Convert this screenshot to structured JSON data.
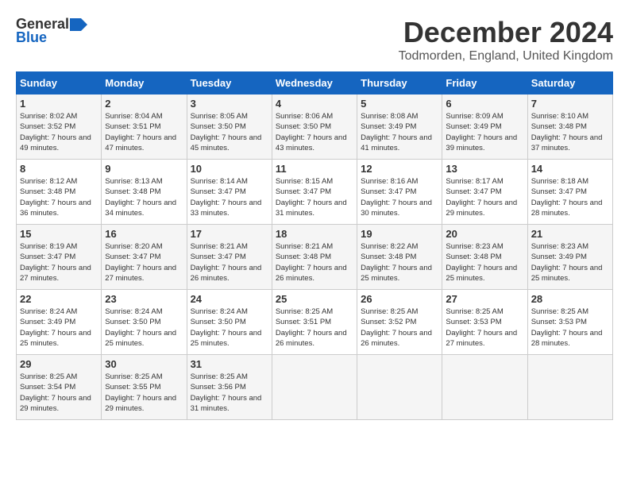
{
  "header": {
    "logo_general": "General",
    "logo_blue": "Blue",
    "month_title": "December 2024",
    "location": "Todmorden, England, United Kingdom"
  },
  "days_of_week": [
    "Sunday",
    "Monday",
    "Tuesday",
    "Wednesday",
    "Thursday",
    "Friday",
    "Saturday"
  ],
  "weeks": [
    [
      {
        "day": "1",
        "sunrise": "8:02 AM",
        "sunset": "3:52 PM",
        "daylight": "7 hours and 49 minutes."
      },
      {
        "day": "2",
        "sunrise": "8:04 AM",
        "sunset": "3:51 PM",
        "daylight": "7 hours and 47 minutes."
      },
      {
        "day": "3",
        "sunrise": "8:05 AM",
        "sunset": "3:50 PM",
        "daylight": "7 hours and 45 minutes."
      },
      {
        "day": "4",
        "sunrise": "8:06 AM",
        "sunset": "3:50 PM",
        "daylight": "7 hours and 43 minutes."
      },
      {
        "day": "5",
        "sunrise": "8:08 AM",
        "sunset": "3:49 PM",
        "daylight": "7 hours and 41 minutes."
      },
      {
        "day": "6",
        "sunrise": "8:09 AM",
        "sunset": "3:49 PM",
        "daylight": "7 hours and 39 minutes."
      },
      {
        "day": "7",
        "sunrise": "8:10 AM",
        "sunset": "3:48 PM",
        "daylight": "7 hours and 37 minutes."
      }
    ],
    [
      {
        "day": "8",
        "sunrise": "8:12 AM",
        "sunset": "3:48 PM",
        "daylight": "7 hours and 36 minutes."
      },
      {
        "day": "9",
        "sunrise": "8:13 AM",
        "sunset": "3:48 PM",
        "daylight": "7 hours and 34 minutes."
      },
      {
        "day": "10",
        "sunrise": "8:14 AM",
        "sunset": "3:47 PM",
        "daylight": "7 hours and 33 minutes."
      },
      {
        "day": "11",
        "sunrise": "8:15 AM",
        "sunset": "3:47 PM",
        "daylight": "7 hours and 31 minutes."
      },
      {
        "day": "12",
        "sunrise": "8:16 AM",
        "sunset": "3:47 PM",
        "daylight": "7 hours and 30 minutes."
      },
      {
        "day": "13",
        "sunrise": "8:17 AM",
        "sunset": "3:47 PM",
        "daylight": "7 hours and 29 minutes."
      },
      {
        "day": "14",
        "sunrise": "8:18 AM",
        "sunset": "3:47 PM",
        "daylight": "7 hours and 28 minutes."
      }
    ],
    [
      {
        "day": "15",
        "sunrise": "8:19 AM",
        "sunset": "3:47 PM",
        "daylight": "7 hours and 27 minutes."
      },
      {
        "day": "16",
        "sunrise": "8:20 AM",
        "sunset": "3:47 PM",
        "daylight": "7 hours and 27 minutes."
      },
      {
        "day": "17",
        "sunrise": "8:21 AM",
        "sunset": "3:47 PM",
        "daylight": "7 hours and 26 minutes."
      },
      {
        "day": "18",
        "sunrise": "8:21 AM",
        "sunset": "3:48 PM",
        "daylight": "7 hours and 26 minutes."
      },
      {
        "day": "19",
        "sunrise": "8:22 AM",
        "sunset": "3:48 PM",
        "daylight": "7 hours and 25 minutes."
      },
      {
        "day": "20",
        "sunrise": "8:23 AM",
        "sunset": "3:48 PM",
        "daylight": "7 hours and 25 minutes."
      },
      {
        "day": "21",
        "sunrise": "8:23 AM",
        "sunset": "3:49 PM",
        "daylight": "7 hours and 25 minutes."
      }
    ],
    [
      {
        "day": "22",
        "sunrise": "8:24 AM",
        "sunset": "3:49 PM",
        "daylight": "7 hours and 25 minutes."
      },
      {
        "day": "23",
        "sunrise": "8:24 AM",
        "sunset": "3:50 PM",
        "daylight": "7 hours and 25 minutes."
      },
      {
        "day": "24",
        "sunrise": "8:24 AM",
        "sunset": "3:50 PM",
        "daylight": "7 hours and 25 minutes."
      },
      {
        "day": "25",
        "sunrise": "8:25 AM",
        "sunset": "3:51 PM",
        "daylight": "7 hours and 26 minutes."
      },
      {
        "day": "26",
        "sunrise": "8:25 AM",
        "sunset": "3:52 PM",
        "daylight": "7 hours and 26 minutes."
      },
      {
        "day": "27",
        "sunrise": "8:25 AM",
        "sunset": "3:53 PM",
        "daylight": "7 hours and 27 minutes."
      },
      {
        "day": "28",
        "sunrise": "8:25 AM",
        "sunset": "3:53 PM",
        "daylight": "7 hours and 28 minutes."
      }
    ],
    [
      {
        "day": "29",
        "sunrise": "8:25 AM",
        "sunset": "3:54 PM",
        "daylight": "7 hours and 29 minutes."
      },
      {
        "day": "30",
        "sunrise": "8:25 AM",
        "sunset": "3:55 PM",
        "daylight": "7 hours and 29 minutes."
      },
      {
        "day": "31",
        "sunrise": "8:25 AM",
        "sunset": "3:56 PM",
        "daylight": "7 hours and 31 minutes."
      },
      null,
      null,
      null,
      null
    ]
  ]
}
